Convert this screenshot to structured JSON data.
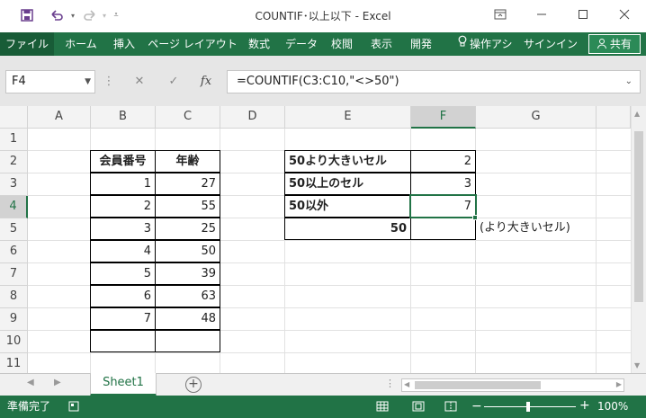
{
  "window": {
    "title": "COUNTIF･以上以下 - Excel",
    "icons": [
      "save-icon",
      "undo-icon",
      "redo-icon",
      "customize-qat-icon",
      "ribbon-display-icon",
      "minimize-icon",
      "maximize-icon",
      "close-icon"
    ]
  },
  "ribbon": {
    "tabs": [
      "ファイル",
      "ホーム",
      "挿入",
      "ページ レイアウト",
      "数式",
      "データ",
      "校閲",
      "表示",
      "開発"
    ],
    "tell_me": "操作アシ",
    "sign_in": "サインイン",
    "share": "共有"
  },
  "formula_bar": {
    "name_box": "F4",
    "formula": "=COUNTIF(C3:C10,\"<>50\")",
    "fx_label": "fx"
  },
  "grid": {
    "columns": [
      "A",
      "B",
      "C",
      "D",
      "E",
      "F",
      "G"
    ],
    "rows": [
      "1",
      "2",
      "3",
      "4",
      "5",
      "6",
      "7",
      "8",
      "9",
      "10",
      "11"
    ],
    "selected_column": "F",
    "selected_row": "4",
    "member_table": {
      "headers": [
        "会員番号",
        "年齢"
      ],
      "rows": [
        [
          "1",
          "27"
        ],
        [
          "2",
          "55"
        ],
        [
          "3",
          "25"
        ],
        [
          "4",
          "50"
        ],
        [
          "5",
          "39"
        ],
        [
          "6",
          "63"
        ],
        [
          "7",
          "48"
        ]
      ]
    },
    "summary_table": {
      "rows": [
        {
          "label": "50より大きいセル",
          "value": "2"
        },
        {
          "label": "50以上のセル",
          "value": "3"
        },
        {
          "label": "50以外",
          "value": "7"
        }
      ],
      "input_label": "50",
      "note": "(より大きいセル)"
    }
  },
  "sheets": {
    "active": "Sheet1",
    "add_label": "+"
  },
  "status_bar": {
    "ready": "準備完了",
    "zoom": "100%"
  },
  "colors": {
    "accent": "#217346",
    "file_tab": "#185c37"
  }
}
